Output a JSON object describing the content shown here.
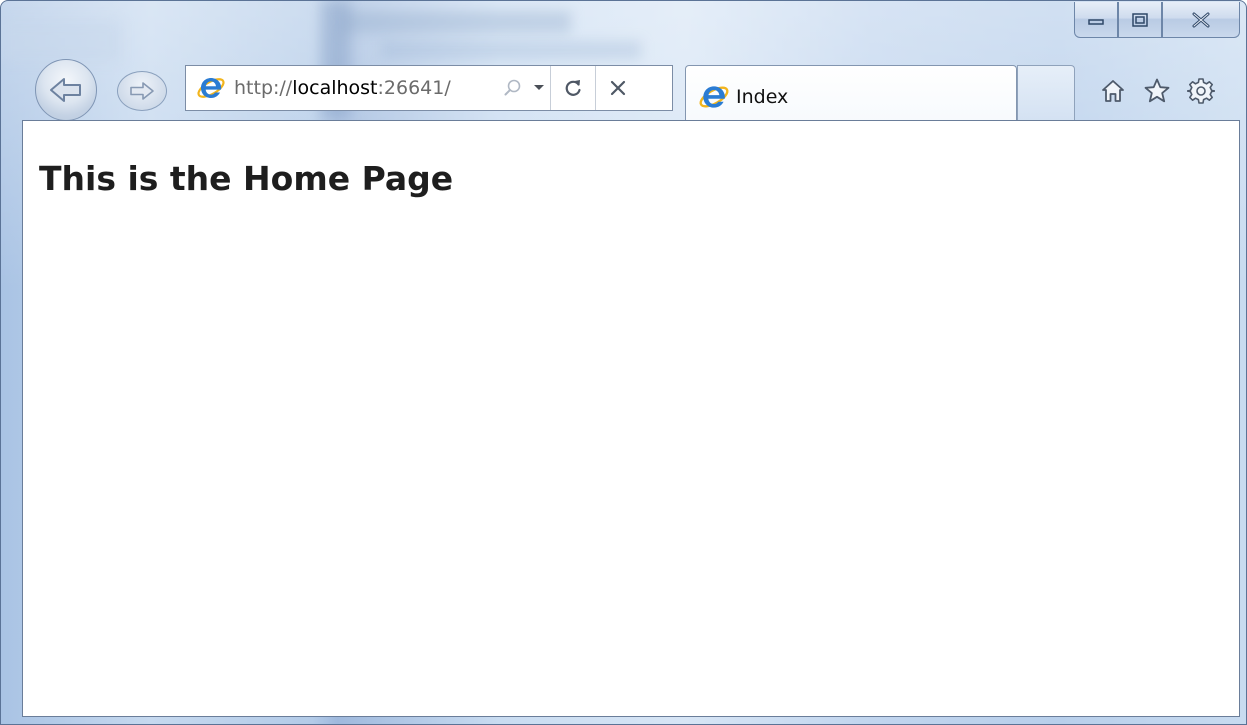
{
  "browser": {
    "address_bar": {
      "url_prefix": "http://",
      "url_host": "localhost",
      "url_suffix": ":26641/"
    },
    "tab": {
      "title": "Index"
    },
    "icons": {
      "back": "arrow-left-icon",
      "forward": "arrow-right-icon",
      "site": "internet-explorer-icon",
      "search": "search-icon",
      "dropdown": "chevron-down-icon",
      "refresh": "refresh-icon",
      "stop": "close-icon",
      "home": "home-icon",
      "favorites": "star-icon",
      "tools": "gear-icon",
      "minimize": "minimize-icon",
      "maximize": "restore-icon",
      "close": "window-close-icon"
    }
  },
  "page": {
    "heading": "This is the Home Page"
  },
  "colors": {
    "frame": "#c6d9ef",
    "ie_blue": "#2b7cd3",
    "ie_gold": "#f2b51d",
    "heading": "#1e1e1e"
  }
}
